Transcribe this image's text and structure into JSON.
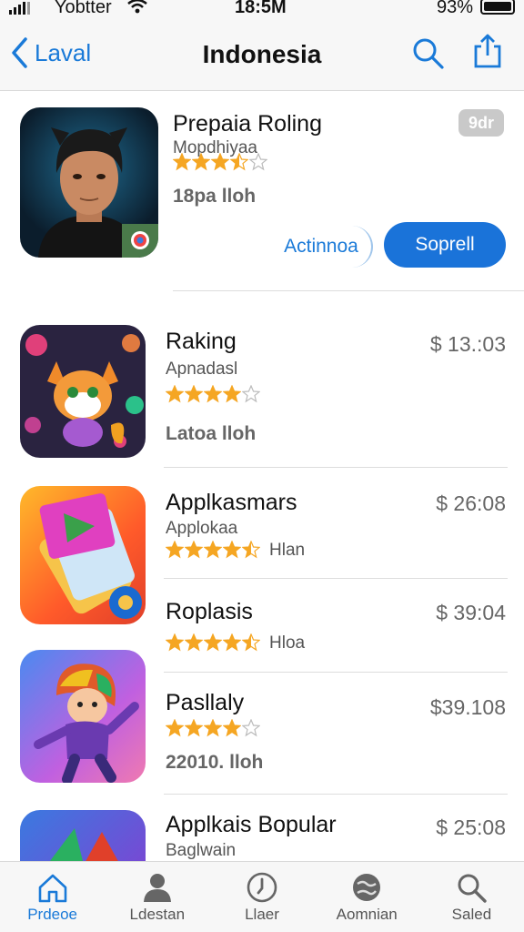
{
  "status": {
    "carrier": "Yobtter",
    "time": "18:5M",
    "battery": "93%"
  },
  "nav": {
    "back_label": "Laval",
    "title": "Indonesia"
  },
  "featured": {
    "name": "Prepaia Roling",
    "subtitle": "Mopdhiyaa",
    "rating": 3.5,
    "meta": "18pa  lloh",
    "age": "9dr",
    "secondary_button": "Actinnoa",
    "primary_button": "Soprell"
  },
  "apps": [
    {
      "name": "Raking",
      "subtitle": "Apnadasl",
      "rating": 4,
      "meta": "Latoa  lloh",
      "price": "$ 13.:03"
    },
    {
      "name": "Applkasmars",
      "subtitle": "Applokaa",
      "rating": 4.5,
      "meta": "Hlan",
      "price": "$ 26:08"
    },
    {
      "name": "Roplasis",
      "subtitle": "",
      "rating": 4.5,
      "meta": "Hloa",
      "price": "$ 39:04"
    },
    {
      "name": "Pasllaly",
      "subtitle": "",
      "rating": 4,
      "meta": "22010.  lloh",
      "price": "$39.108"
    },
    {
      "name": "Applkais Bopular",
      "subtitle": "Baglwain",
      "rating": 0,
      "meta": "",
      "price": "$ 25:08"
    }
  ],
  "tabs": [
    {
      "label": "Prdeoe",
      "icon": "home-icon"
    },
    {
      "label": "Ldestan",
      "icon": "person-icon"
    },
    {
      "label": "Llaer",
      "icon": "clock-icon"
    },
    {
      "label": "Aomnian",
      "icon": "globe-icon"
    },
    {
      "label": "Saled",
      "icon": "search-icon"
    }
  ],
  "colors": {
    "accent": "#1a73d9",
    "star": "#f5a623",
    "star_empty": "#bbbbbb"
  }
}
